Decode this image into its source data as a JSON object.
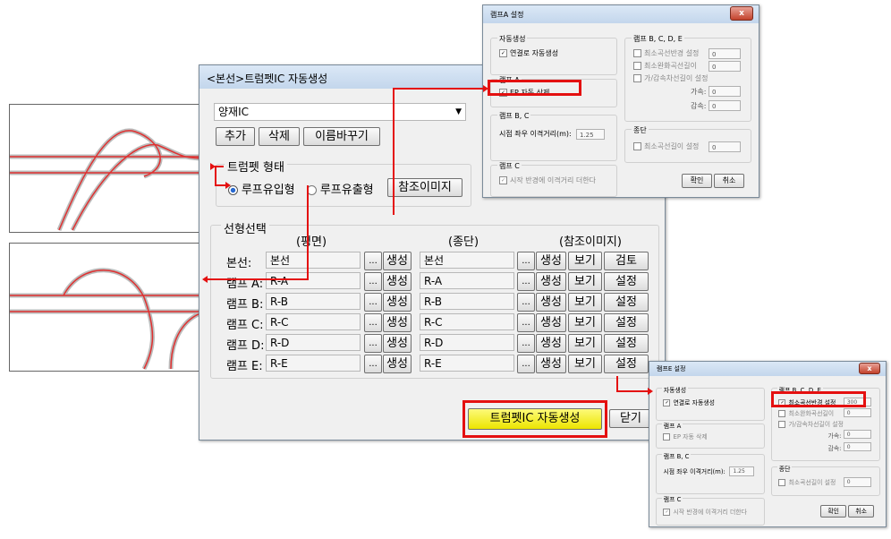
{
  "main_window": {
    "title": "<본선>트럼펫IC 자동생성",
    "ic_select": "양재IC",
    "buttons": {
      "add": "추가",
      "delete": "삭제",
      "rename": "이름바꾸기"
    },
    "type_group": {
      "label": "트럼펫 형태",
      "option_inflow": "루프유입형",
      "option_outflow": "루프유출형",
      "selected": "루프유입형",
      "ref_image_button": "참조이미지"
    },
    "alignment_group": {
      "label": "선형선택",
      "col_plan": "(평면)",
      "col_profile": "(종단)",
      "col_ref_image": "(참조이미지)",
      "browse_label": "...",
      "generate_label": "생성",
      "view_label": "보기",
      "rows": [
        {
          "name": "본선:",
          "plan": "본선",
          "profile": "본선",
          "action": "검토"
        },
        {
          "name": "램프 A:",
          "plan": "R-A",
          "profile": "R-A",
          "action": "설정"
        },
        {
          "name": "램프 B:",
          "plan": "R-B",
          "profile": "R-B",
          "action": "설정"
        },
        {
          "name": "램프 C:",
          "plan": "R-C",
          "profile": "R-C",
          "action": "설정"
        },
        {
          "name": "램프 D:",
          "plan": "R-D",
          "profile": "R-D",
          "action": "설정"
        },
        {
          "name": "램프 E:",
          "plan": "R-E",
          "profile": "R-E",
          "action": "설정"
        }
      ]
    },
    "generate_button": "트럼펫IC 자동생성",
    "close_button": "닫기"
  },
  "rampA_dialog": {
    "title": "램프A 설정",
    "auto_group": "자동생성",
    "auto_connect": "연결로 자동생성",
    "rampA_group": "램프 A",
    "ep_delete": "EP 자동 삭제",
    "rampBC_group": "램프 B, C",
    "offset_label": "시점 좌우 이격거리(m):",
    "offset_value": "1.25",
    "rampC_group": "램프 C",
    "rampC_option": "시작 반경에 이격거리 더한다",
    "rampBCDE_group": "램프 B, C, D, E",
    "min_radius": "최소곡선반경 설정",
    "min_radius_value": "0",
    "min_transition": "최소완화곡선길이",
    "min_transition_value": "0",
    "accel_decel": "가/감속차선길이 설정",
    "accel_label": "가속:",
    "accel_value": "0",
    "decel_label": "감속:",
    "decel_value": "0",
    "profile_group": "종단",
    "min_curve_len": "최소곡선길이 설정",
    "min_curve_len_value": "0",
    "ok": "확인",
    "cancel": "취소"
  },
  "rampE_dialog": {
    "title": "램프E 설정",
    "auto_group": "자동생성",
    "auto_connect": "연결로 자동생성",
    "rampA_group": "램프 A",
    "ep_delete": "EP 자동 삭제",
    "rampBC_group": "램프 B, C",
    "offset_label": "시점 좌우 이격거리(m):",
    "offset_value": "1.25",
    "rampC_group": "램프 C",
    "rampC_option": "시작 반경에 이격거리 더한다",
    "rampBCDE_group": "램프 B, C, D, E",
    "min_radius": "최소곡선반경 설정",
    "min_radius_value": "300",
    "min_transition": "최소완화곡선길이",
    "min_transition_value": "0",
    "accel_decel": "가/감속차선길이 설정",
    "accel_label": "가속:",
    "accel_value": "0",
    "decel_label": "감속:",
    "decel_value": "0",
    "profile_group": "종단",
    "min_curve_len": "최소곡선길이 설정",
    "min_curve_len_value": "0",
    "ok": "확인",
    "cancel": "취소"
  },
  "colors": {
    "highlight": "#e41010",
    "generate_button": "#f5f100",
    "road": "#e03030"
  }
}
